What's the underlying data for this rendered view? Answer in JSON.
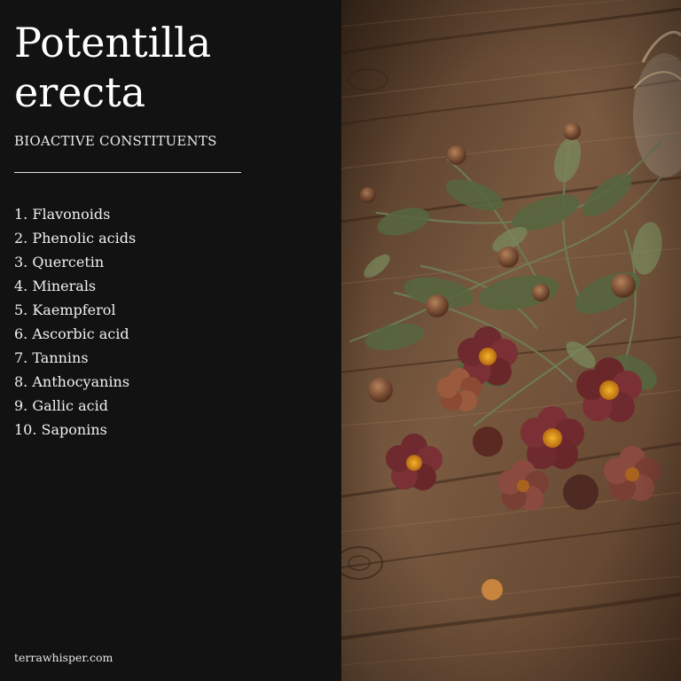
{
  "title": "Potentilla erecta",
  "subtitle": "BIOACTIVE CONSTITUENTS",
  "constituents": [
    "1. Flavonoids",
    "2. Phenolic acids",
    "3. Quercetin",
    "4. Minerals",
    "5. Kaempferol",
    "6. Ascorbic acid",
    "7. Tannins",
    "8. Anthocyanins",
    "9. Gallic acid",
    "10. Saponins"
  ],
  "footer": "terrawhisper.com",
  "colors": {
    "panel_background": "#121212",
    "text": "#f2f2f2",
    "wood": "#6b4a33",
    "petal": "#6e2a2e",
    "flower_center": "#e5a21a",
    "leaf": "#5a6b45"
  },
  "image": {
    "subject": "dried tormentil flowers and herbs on a rustic wooden table"
  }
}
